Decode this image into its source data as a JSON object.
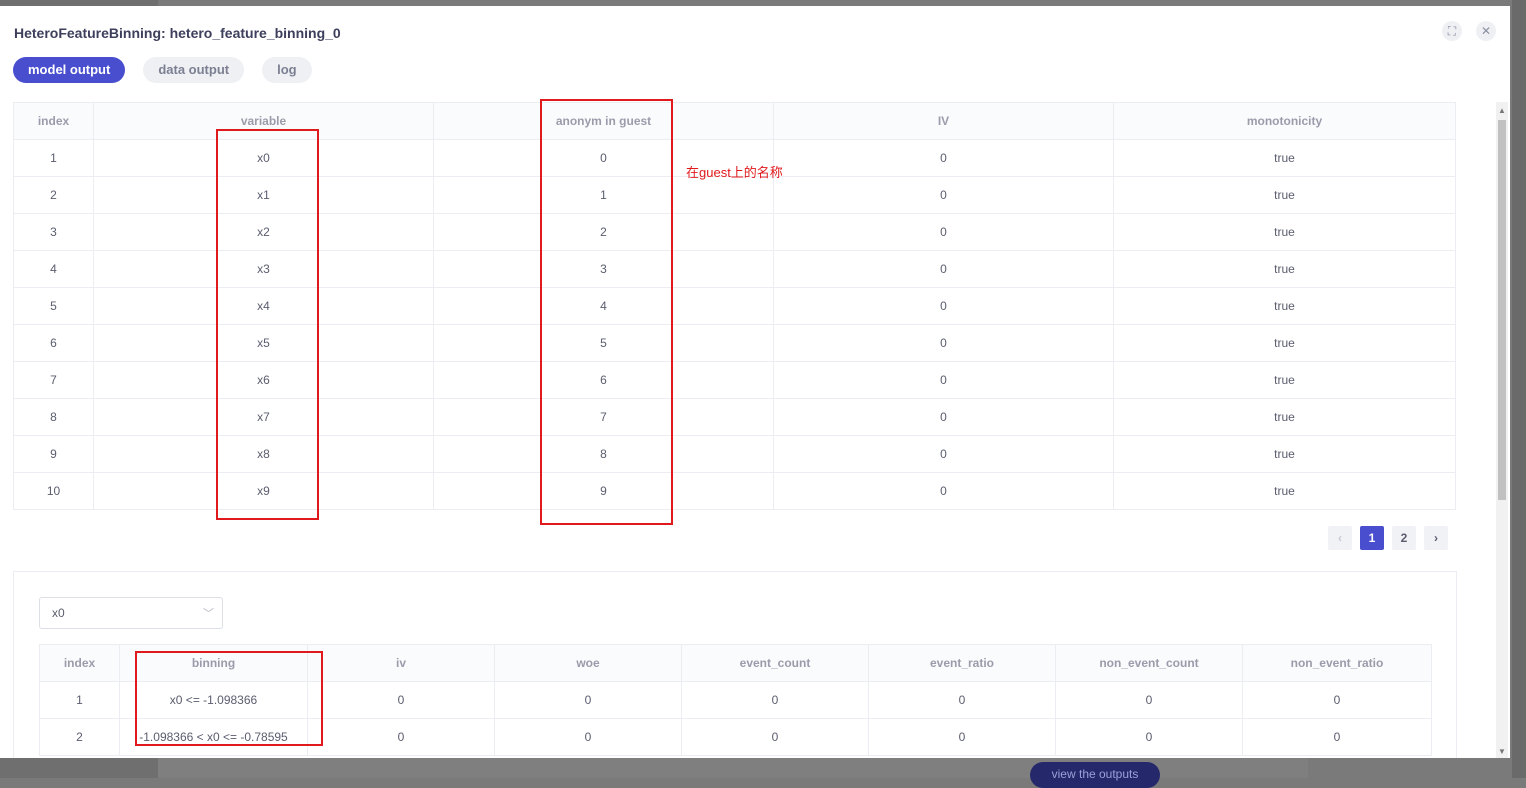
{
  "dialog": {
    "title": "HeteroFeatureBinning: hetero_feature_binning_0",
    "tabs": [
      "model output",
      "data output",
      "log"
    ],
    "fullscreen_icon": "fullscreen-icon",
    "close_icon": "close-icon"
  },
  "table1": {
    "headers": [
      "index",
      "variable",
      "anonym in guest",
      "IV",
      "monotonicity"
    ],
    "rows": [
      [
        "1",
        "x0",
        "0",
        "0",
        "true"
      ],
      [
        "2",
        "x1",
        "1",
        "0",
        "true"
      ],
      [
        "3",
        "x2",
        "2",
        "0",
        "true"
      ],
      [
        "4",
        "x3",
        "3",
        "0",
        "true"
      ],
      [
        "5",
        "x4",
        "4",
        "0",
        "true"
      ],
      [
        "6",
        "x5",
        "5",
        "0",
        "true"
      ],
      [
        "7",
        "x6",
        "6",
        "0",
        "true"
      ],
      [
        "8",
        "x7",
        "7",
        "0",
        "true"
      ],
      [
        "9",
        "x8",
        "8",
        "0",
        "true"
      ],
      [
        "10",
        "x9",
        "9",
        "0",
        "true"
      ]
    ]
  },
  "pagination": {
    "prev": "‹",
    "pages": [
      "1",
      "2"
    ],
    "current": "1",
    "next": "›"
  },
  "annotation": "在guest上的名称",
  "detail": {
    "select_value": "x0",
    "headers": [
      "index",
      "binning",
      "iv",
      "woe",
      "event_count",
      "event_ratio",
      "non_event_count",
      "non_event_ratio"
    ],
    "rows": [
      [
        "1",
        "x0 <= -1.098366",
        "0",
        "0",
        "0",
        "0",
        "0",
        "0"
      ],
      [
        "2",
        "-1.098366 < x0 <= -0.78595",
        "0",
        "0",
        "0",
        "0",
        "0",
        "0"
      ]
    ]
  },
  "background_button": "view the outputs",
  "colors": {
    "accent": "#494ece",
    "annotation": "#e0191c"
  }
}
